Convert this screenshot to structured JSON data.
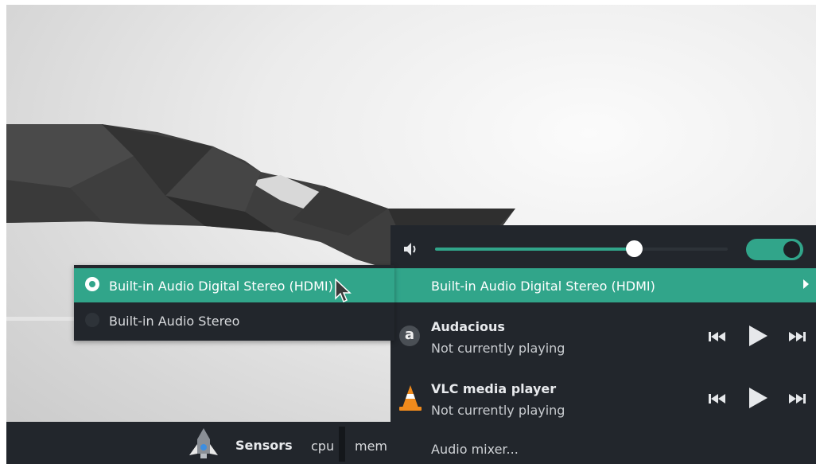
{
  "taskbar": {
    "widget_title": "Sensors",
    "cpu_label": "cpu",
    "mem_label": "mem"
  },
  "audio_popup": {
    "volume_percent": 68,
    "mute_toggle_on": true,
    "output_device": "Built-in Audio Digital Stereo (HDMI)",
    "players": [
      {
        "name": "Audacious",
        "status": "Not currently playing",
        "icon": "audacious-icon"
      },
      {
        "name": "VLC media player",
        "status": "Not currently playing",
        "icon": "vlc-cone-icon"
      }
    ],
    "mixer_label": "Audio mixer..."
  },
  "device_submenu": {
    "options": [
      {
        "label": "Built-in Audio Digital Stereo (HDMI)",
        "selected": true
      },
      {
        "label": "Built-in Audio Stereo",
        "selected": false
      }
    ]
  },
  "colors": {
    "accent": "#31a58a",
    "panel": "#22262c"
  }
}
